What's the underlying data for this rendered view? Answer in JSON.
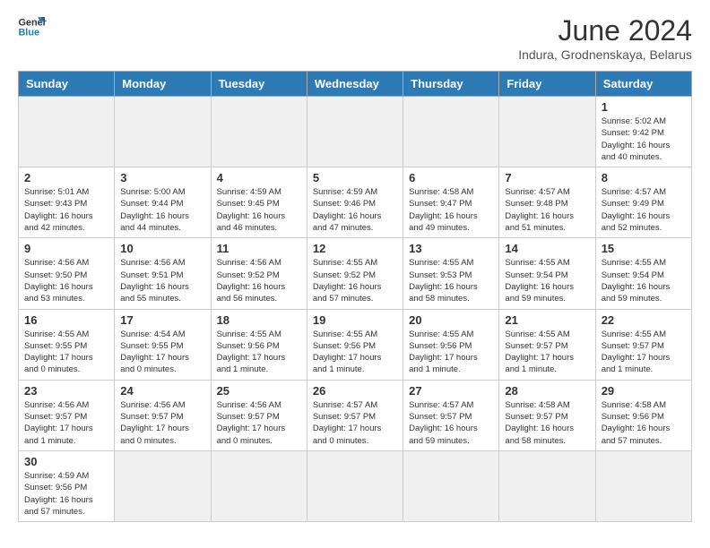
{
  "logo": {
    "line1": "General",
    "line2": "Blue"
  },
  "title": "June 2024",
  "subtitle": "Indura, Grodnenskaya, Belarus",
  "days_of_week": [
    "Sunday",
    "Monday",
    "Tuesday",
    "Wednesday",
    "Thursday",
    "Friday",
    "Saturday"
  ],
  "weeks": [
    [
      {
        "day": "",
        "info": ""
      },
      {
        "day": "",
        "info": ""
      },
      {
        "day": "",
        "info": ""
      },
      {
        "day": "",
        "info": ""
      },
      {
        "day": "",
        "info": ""
      },
      {
        "day": "",
        "info": ""
      },
      {
        "day": "1",
        "info": "Sunrise: 5:02 AM\nSunset: 9:42 PM\nDaylight: 16 hours\nand 40 minutes."
      }
    ],
    [
      {
        "day": "2",
        "info": "Sunrise: 5:01 AM\nSunset: 9:43 PM\nDaylight: 16 hours\nand 42 minutes."
      },
      {
        "day": "3",
        "info": "Sunrise: 5:00 AM\nSunset: 9:44 PM\nDaylight: 16 hours\nand 44 minutes."
      },
      {
        "day": "4",
        "info": "Sunrise: 4:59 AM\nSunset: 9:45 PM\nDaylight: 16 hours\nand 46 minutes."
      },
      {
        "day": "5",
        "info": "Sunrise: 4:59 AM\nSunset: 9:46 PM\nDaylight: 16 hours\nand 47 minutes."
      },
      {
        "day": "6",
        "info": "Sunrise: 4:58 AM\nSunset: 9:47 PM\nDaylight: 16 hours\nand 49 minutes."
      },
      {
        "day": "7",
        "info": "Sunrise: 4:57 AM\nSunset: 9:48 PM\nDaylight: 16 hours\nand 51 minutes."
      },
      {
        "day": "8",
        "info": "Sunrise: 4:57 AM\nSunset: 9:49 PM\nDaylight: 16 hours\nand 52 minutes."
      }
    ],
    [
      {
        "day": "9",
        "info": "Sunrise: 4:56 AM\nSunset: 9:50 PM\nDaylight: 16 hours\nand 53 minutes."
      },
      {
        "day": "10",
        "info": "Sunrise: 4:56 AM\nSunset: 9:51 PM\nDaylight: 16 hours\nand 55 minutes."
      },
      {
        "day": "11",
        "info": "Sunrise: 4:56 AM\nSunset: 9:52 PM\nDaylight: 16 hours\nand 56 minutes."
      },
      {
        "day": "12",
        "info": "Sunrise: 4:55 AM\nSunset: 9:52 PM\nDaylight: 16 hours\nand 57 minutes."
      },
      {
        "day": "13",
        "info": "Sunrise: 4:55 AM\nSunset: 9:53 PM\nDaylight: 16 hours\nand 58 minutes."
      },
      {
        "day": "14",
        "info": "Sunrise: 4:55 AM\nSunset: 9:54 PM\nDaylight: 16 hours\nand 59 minutes."
      },
      {
        "day": "15",
        "info": "Sunrise: 4:55 AM\nSunset: 9:54 PM\nDaylight: 16 hours\nand 59 minutes."
      }
    ],
    [
      {
        "day": "16",
        "info": "Sunrise: 4:55 AM\nSunset: 9:55 PM\nDaylight: 17 hours\nand 0 minutes."
      },
      {
        "day": "17",
        "info": "Sunrise: 4:54 AM\nSunset: 9:55 PM\nDaylight: 17 hours\nand 0 minutes."
      },
      {
        "day": "18",
        "info": "Sunrise: 4:55 AM\nSunset: 9:56 PM\nDaylight: 17 hours\nand 1 minute."
      },
      {
        "day": "19",
        "info": "Sunrise: 4:55 AM\nSunset: 9:56 PM\nDaylight: 17 hours\nand 1 minute."
      },
      {
        "day": "20",
        "info": "Sunrise: 4:55 AM\nSunset: 9:56 PM\nDaylight: 17 hours\nand 1 minute."
      },
      {
        "day": "21",
        "info": "Sunrise: 4:55 AM\nSunset: 9:57 PM\nDaylight: 17 hours\nand 1 minute."
      },
      {
        "day": "22",
        "info": "Sunrise: 4:55 AM\nSunset: 9:57 PM\nDaylight: 17 hours\nand 1 minute."
      }
    ],
    [
      {
        "day": "23",
        "info": "Sunrise: 4:56 AM\nSunset: 9:57 PM\nDaylight: 17 hours\nand 1 minute."
      },
      {
        "day": "24",
        "info": "Sunrise: 4:56 AM\nSunset: 9:57 PM\nDaylight: 17 hours\nand 0 minutes."
      },
      {
        "day": "25",
        "info": "Sunrise: 4:56 AM\nSunset: 9:57 PM\nDaylight: 17 hours\nand 0 minutes."
      },
      {
        "day": "26",
        "info": "Sunrise: 4:57 AM\nSunset: 9:57 PM\nDaylight: 17 hours\nand 0 minutes."
      },
      {
        "day": "27",
        "info": "Sunrise: 4:57 AM\nSunset: 9:57 PM\nDaylight: 16 hours\nand 59 minutes."
      },
      {
        "day": "28",
        "info": "Sunrise: 4:58 AM\nSunset: 9:57 PM\nDaylight: 16 hours\nand 58 minutes."
      },
      {
        "day": "29",
        "info": "Sunrise: 4:58 AM\nSunset: 9:56 PM\nDaylight: 16 hours\nand 57 minutes."
      }
    ],
    [
      {
        "day": "30",
        "info": "Sunrise: 4:59 AM\nSunset: 9:56 PM\nDaylight: 16 hours\nand 57 minutes."
      },
      {
        "day": "",
        "info": ""
      },
      {
        "day": "",
        "info": ""
      },
      {
        "day": "",
        "info": ""
      },
      {
        "day": "",
        "info": ""
      },
      {
        "day": "",
        "info": ""
      },
      {
        "day": "",
        "info": ""
      }
    ]
  ]
}
